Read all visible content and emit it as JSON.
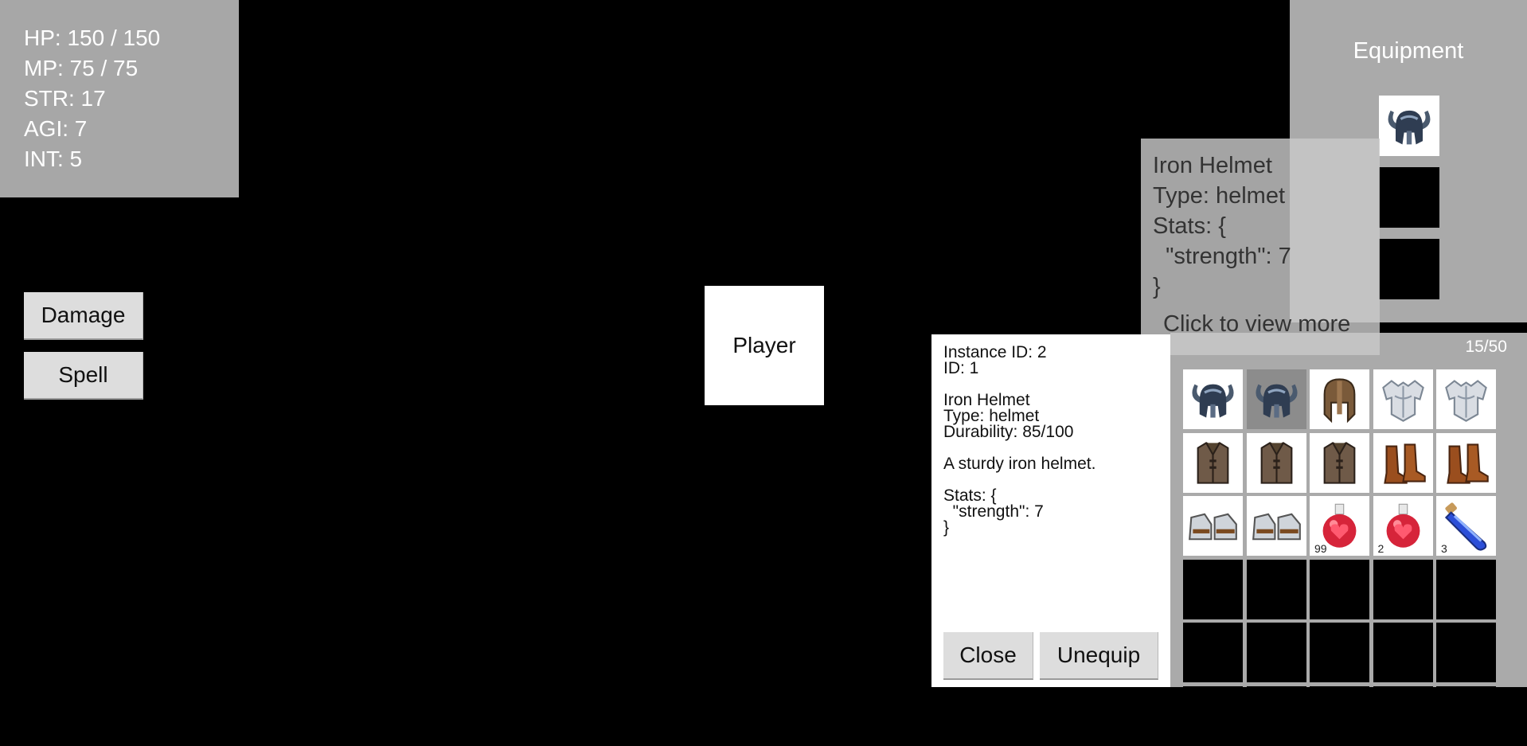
{
  "stats": {
    "hp": "HP: 150 / 150",
    "mp": "MP: 75 / 75",
    "str": "STR: 17",
    "agi": "AGI: 7",
    "int": "INT: 5"
  },
  "actions": {
    "damage_label": "Damage",
    "spell_label": "Spell"
  },
  "player": {
    "label": "Player"
  },
  "equipment": {
    "title": "Equipment",
    "slots": [
      {
        "item": "iron-helmet-icon"
      },
      {
        "item": null
      },
      {
        "item": null
      }
    ]
  },
  "tooltip": {
    "name": "Iron Helmet",
    "type": "Type: helmet",
    "stats_open": "Stats: {",
    "stats_line": "  \"strength\": 7",
    "stats_close": "}",
    "hint": "Click to view more"
  },
  "inventory": {
    "count": "15/50",
    "items": [
      {
        "icon": "horned-helmet-icon",
        "qty": ""
      },
      {
        "icon": "horned-helmet-icon",
        "qty": "",
        "selected": true
      },
      {
        "icon": "bronze-helmet-icon",
        "qty": ""
      },
      {
        "icon": "silver-chestplate-icon",
        "qty": ""
      },
      {
        "icon": "silver-chestplate-icon",
        "qty": ""
      },
      {
        "icon": "leather-armor-icon",
        "qty": ""
      },
      {
        "icon": "leather-armor-icon",
        "qty": ""
      },
      {
        "icon": "leather-armor-icon",
        "qty": ""
      },
      {
        "icon": "leather-boots-icon",
        "qty": ""
      },
      {
        "icon": "leather-boots-icon",
        "qty": ""
      },
      {
        "icon": "steel-boots-icon",
        "qty": ""
      },
      {
        "icon": "steel-boots-icon",
        "qty": ""
      },
      {
        "icon": "health-potion-icon",
        "qty": "99"
      },
      {
        "icon": "health-potion-icon",
        "qty": "2"
      },
      {
        "icon": "mana-vial-icon",
        "qty": "3"
      }
    ]
  },
  "detail": {
    "instance_id": "Instance ID: 2",
    "id": "ID: 1",
    "name": "Iron Helmet",
    "type": "Type: helmet",
    "durability": "Durability: 85/100",
    "description": "A sturdy iron helmet.",
    "stats_open": "Stats: {",
    "stats_line": "  \"strength\": 7",
    "stats_close": "}",
    "close_label": "Close",
    "unequip_label": "Unequip"
  },
  "colors": {
    "panel_gray": "#aaaaaa",
    "button_gray": "#dddddd",
    "background": "#000000"
  }
}
